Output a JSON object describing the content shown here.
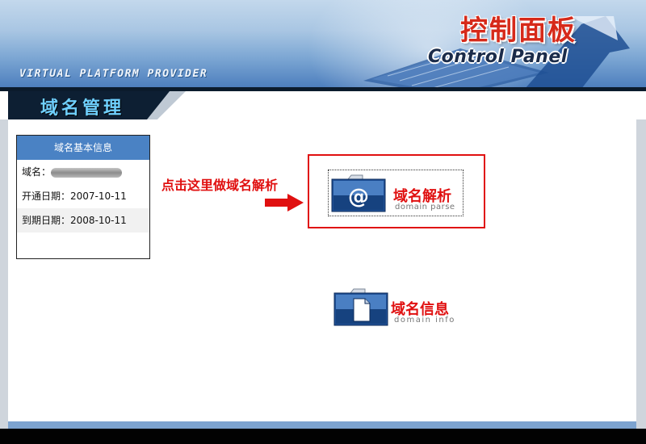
{
  "header": {
    "tagline": "VIRTUAL PLATFORM PROVIDER",
    "title_cn": "控制面板",
    "title_en": "Control Panel"
  },
  "section": {
    "title": "域名管理"
  },
  "info_box": {
    "header": "域名基本信息",
    "rows": [
      {
        "label": "域名：",
        "value": ""
      },
      {
        "label": "开通日期：",
        "value": "2007-10-11"
      },
      {
        "label": "到期日期：",
        "value": "2008-10-11"
      }
    ]
  },
  "annotation": {
    "hint": "点击这里做域名解析"
  },
  "buttons": {
    "domain_parse": {
      "label_cn": "域名解析",
      "label_en": "domain parse",
      "icon": "at-sign-folder-icon"
    },
    "domain_info": {
      "label_cn": "域名信息",
      "label_en": "domain info",
      "icon": "document-folder-icon"
    }
  },
  "colors": {
    "accent_red": "#e01010",
    "header_blue": "#4a82c4",
    "section_text": "#6fd0ff"
  }
}
